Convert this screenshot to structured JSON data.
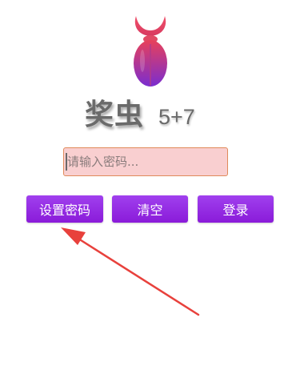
{
  "app": {
    "name": "奖虫",
    "version": "5+7",
    "logo_icon": "beetle-logo-icon"
  },
  "password": {
    "placeholder": "请输入密码...",
    "value": ""
  },
  "buttons": {
    "set_password": "设置密码",
    "clear": "清空",
    "login": "登录"
  },
  "annotation": {
    "icon": "red-arrow-icon",
    "color": "#e8413c"
  },
  "colors": {
    "button_bg": "#9530e6",
    "input_bg": "#f9cfd0",
    "input_border": "#e08a5a",
    "logo_top": "#e8415a",
    "logo_bottom": "#7a2dd0"
  }
}
